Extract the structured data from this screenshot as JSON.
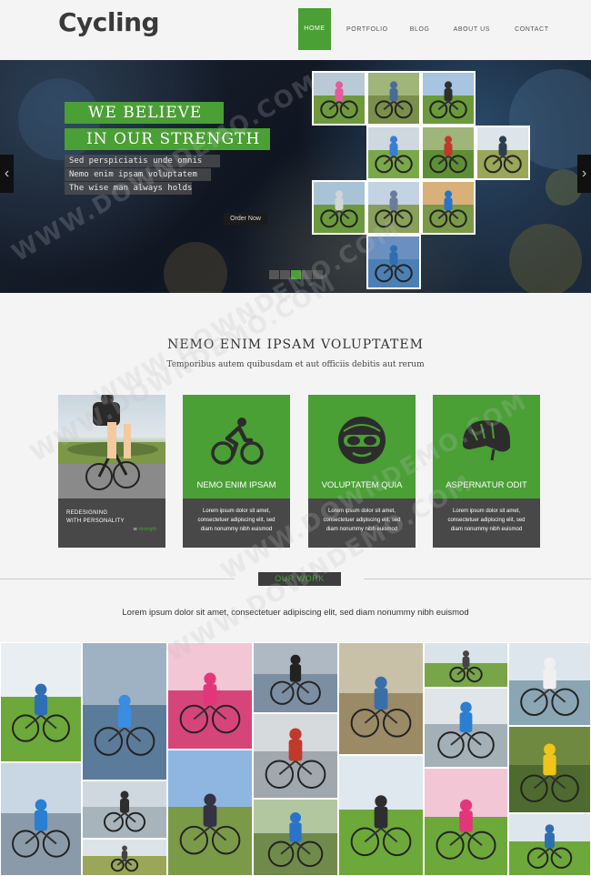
{
  "brand": {
    "logo": "Cycling"
  },
  "nav": {
    "items": [
      {
        "label": "HOME",
        "active": true
      },
      {
        "label": "PORTFOLIO"
      },
      {
        "label": "BLOG"
      },
      {
        "label": "ABOUT US"
      },
      {
        "label": "CONTACT"
      }
    ]
  },
  "hero": {
    "headline_1": "WE BELIEVE",
    "headline_2": "IN OUR STRENGTH",
    "lines": [
      "Sed perspiciatis unde omnis",
      "Nemo enim ipsam voluptatem",
      "The wise man always holds"
    ],
    "cta": "Order Now",
    "prev_icon": "chevron-left-icon",
    "next_icon": "chevron-right-icon",
    "slide_count": 5,
    "active_slide": 3
  },
  "intro": {
    "title": "NEMO ENIM IPSAM VOLUPTATEM",
    "subtitle": "Temporibus autem quibusdam et aut officiis debitis aut rerum"
  },
  "cards": [
    {
      "label_1": "REDESIGNING",
      "label_2": "WITH PERSONALITY",
      "brand_a": "w",
      "brand_b": "strength"
    },
    {
      "title": "NEMO ENIM IPSAM",
      "text_1": "Lorem ipsum dolor sit amet,",
      "text_2": "consectetuer adipiscing elit, sed",
      "text_3": "diam nonummy nibh euismod",
      "icon": "cyclist-icon"
    },
    {
      "title": "VOLUPTATEM QUIA",
      "text_1": "Lorem ipsum dolor sit amet,",
      "text_2": "consectetuer adipiscing elit, sed",
      "text_3": "diam nonummy nibh euismod",
      "icon": "helmet-goggles-icon"
    },
    {
      "title": "ASPERNATUR ODIT",
      "text_1": "Lorem ipsum dolor sit amet,",
      "text_2": "consectetuer adipiscing elit, sed",
      "text_3": "diam nonummy nibh euismod",
      "icon": "helmet-icon"
    }
  ],
  "work": {
    "label": "OUR WORK",
    "text": "Lorem ipsum dolor sit amet, consectetuer adipiscing elit, sed diam nonummy nibh euismod"
  },
  "colors": {
    "accent": "#4a9f35",
    "dark": "#484848",
    "background": "#f4f4f4"
  },
  "watermark": "WWW.DOWNDEMO.COM"
}
